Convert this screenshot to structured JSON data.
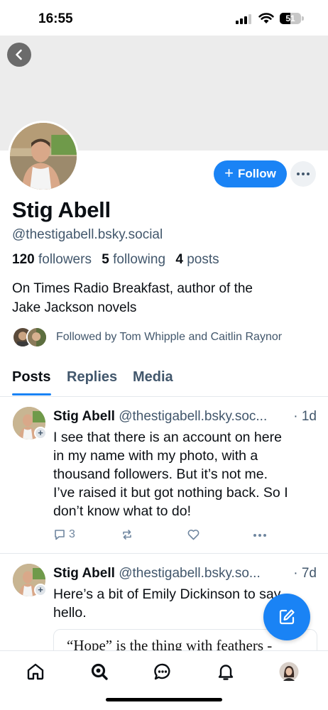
{
  "status_bar": {
    "time": "16:55",
    "battery": "51",
    "battery_level": 0.51
  },
  "profile": {
    "display_name": "Stig Abell",
    "handle": "@thestigabell.bsky.social",
    "follow_label": "Follow",
    "followers_count": "120",
    "followers_label": "followers",
    "following_count": "5",
    "following_label": "following",
    "posts_count": "4",
    "posts_label": "posts",
    "bio_line1": "On Times Radio Breakfast, author of the",
    "bio_line2": "Jake Jackson novels",
    "followed_by": "Followed by Tom Whipple and Caitlin Raynor"
  },
  "tabs": [
    {
      "label": "Posts",
      "active": true
    },
    {
      "label": "Replies",
      "active": false
    },
    {
      "label": "Media",
      "active": false
    }
  ],
  "posts": [
    {
      "author": "Stig Abell",
      "handle": "@thestigabell.bsky.soc...",
      "time": "· 1d",
      "lines": [
        "I see that there is an account on here",
        "in my name with my photo, with a",
        "thousand followers. But it’s not me.",
        "I’ve raised it but got nothing back. So I",
        "don’t know what to do!"
      ],
      "reply_count": "3"
    },
    {
      "author": "Stig Abell",
      "handle": "@thestigabell.bsky.so...",
      "time": "· 7d",
      "lines": [
        "Here’s a bit of Emily Dickinson to say",
        "hello."
      ],
      "quote": "“Hope” is the thing with feathers -"
    }
  ],
  "colors": {
    "accent": "#1a83f5",
    "muted": "#42576c",
    "divider": "#e4e8ec"
  },
  "icons": [
    "chevron-left-icon",
    "plus-icon",
    "ellipsis-icon",
    "reply-icon",
    "repost-icon",
    "like-icon",
    "compose-icon",
    "home-icon",
    "search-icon",
    "chat-icon",
    "bell-icon"
  ]
}
